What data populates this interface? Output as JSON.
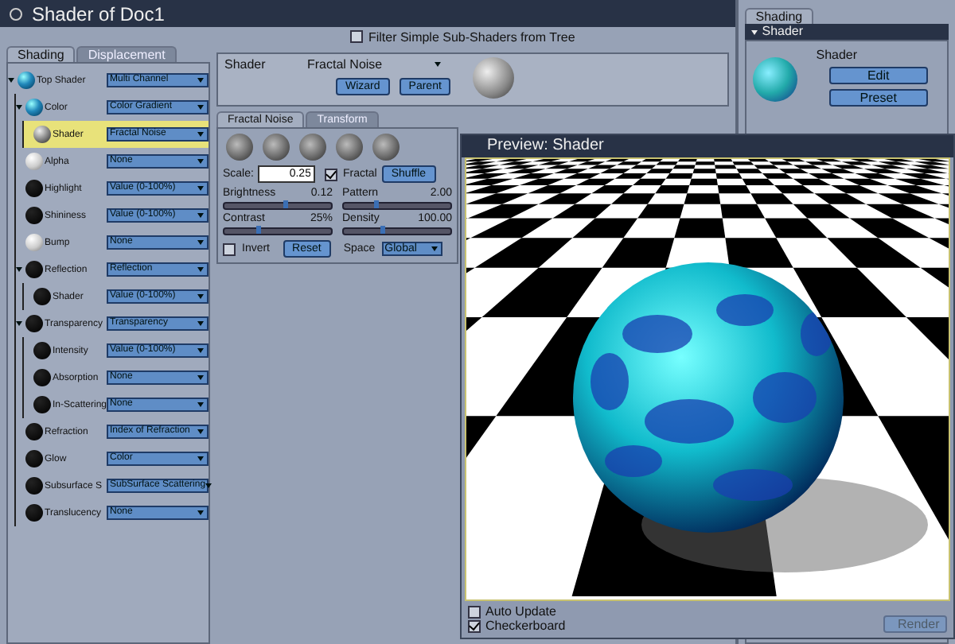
{
  "window": {
    "title": "Shader of Doc1"
  },
  "filter": {
    "label": "Filter Simple Sub-Shaders from Tree",
    "checked": false
  },
  "tabs": [
    {
      "label": "Shading",
      "selected": true
    },
    {
      "label": "Displacement",
      "selected": false
    }
  ],
  "tree": [
    {
      "label": "Top Shader",
      "kind": "blue",
      "value": "Multi Channel",
      "selected": false,
      "expanded": true,
      "children": [
        {
          "label": "Color",
          "kind": "blue",
          "value": "Color Gradient",
          "selected": false,
          "expanded": true,
          "children": [
            {
              "label": "Shader",
              "kind": "metal",
              "value": "Fractal Noise",
              "selected": true,
              "expanded": false
            }
          ]
        },
        {
          "label": "Alpha",
          "kind": "white",
          "value": "None",
          "selected": false,
          "expanded": false
        },
        {
          "label": "Highlight",
          "kind": "black",
          "value": "Value (0-100%)",
          "selected": false,
          "expanded": false
        },
        {
          "label": "Shininess",
          "kind": "black",
          "value": "Value (0-100%)",
          "selected": false,
          "expanded": false
        },
        {
          "label": "Bump",
          "kind": "white",
          "value": "None",
          "selected": false,
          "expanded": false
        },
        {
          "label": "Reflection",
          "kind": "black",
          "value": "Reflection",
          "selected": false,
          "expanded": true,
          "children": [
            {
              "label": "Shader",
              "kind": "black",
              "value": "Value (0-100%)",
              "selected": false,
              "expanded": false
            }
          ]
        },
        {
          "label": "Transparency",
          "kind": "black",
          "value": "Transparency",
          "selected": false,
          "expanded": true,
          "children": [
            {
              "label": "Intensity",
              "kind": "black",
              "value": "Value (0-100%)",
              "selected": false,
              "expanded": false
            },
            {
              "label": "Absorption",
              "kind": "black",
              "value": "None",
              "selected": false,
              "expanded": false
            },
            {
              "label": "In-Scattering",
              "kind": "black",
              "value": "None",
              "selected": false,
              "expanded": false
            }
          ]
        },
        {
          "label": "Refraction",
          "kind": "black",
          "value": "Index of Refraction",
          "selected": false,
          "expanded": false
        },
        {
          "label": "Glow",
          "kind": "black",
          "value": "Color",
          "selected": false,
          "expanded": false
        },
        {
          "label": "Subsurface S",
          "kind": "black",
          "value": "SubSurface Scattering",
          "selected": false,
          "expanded": false
        },
        {
          "label": "Translucency",
          "kind": "black",
          "value": "None",
          "selected": false,
          "expanded": false
        }
      ]
    }
  ],
  "shader_panel": {
    "label": "Shader",
    "name": "Fractal Noise",
    "buttons": [
      "Wizard",
      "Parent"
    ]
  },
  "sub_tabs": [
    {
      "label": "Fractal Noise",
      "selected": true
    },
    {
      "label": "Transform",
      "selected": false
    }
  ],
  "scale": {
    "label": "Scale:",
    "value": "0.25"
  },
  "fractal": {
    "label": "Fractal",
    "checked": true
  },
  "shuffle": "Shuffle",
  "sliders": [
    {
      "label": "Brightness",
      "reading": "0.12",
      "level": 0.55
    },
    {
      "label": "Pattern",
      "reading": "2.00",
      "level": 0.28
    },
    {
      "label": "Contrast",
      "reading": "25%",
      "level": 0.3
    },
    {
      "label": "Density",
      "reading": "100.00",
      "level": 0.35
    }
  ],
  "invert": {
    "label": "Invert",
    "checked": false
  },
  "reset": "Reset",
  "space": {
    "label": "Space",
    "value": "Global"
  },
  "right_panel": {
    "tab": "Shading",
    "header": "Shader",
    "label": "Shader",
    "buttons": [
      "Edit",
      "Preset"
    ]
  },
  "preview": {
    "title": "Preview: Shader",
    "options": [
      {
        "label": "Auto Update",
        "checked": false
      },
      {
        "label": "Checkerboard",
        "checked": true
      }
    ],
    "render": "Render",
    "render_disabled": true
  }
}
